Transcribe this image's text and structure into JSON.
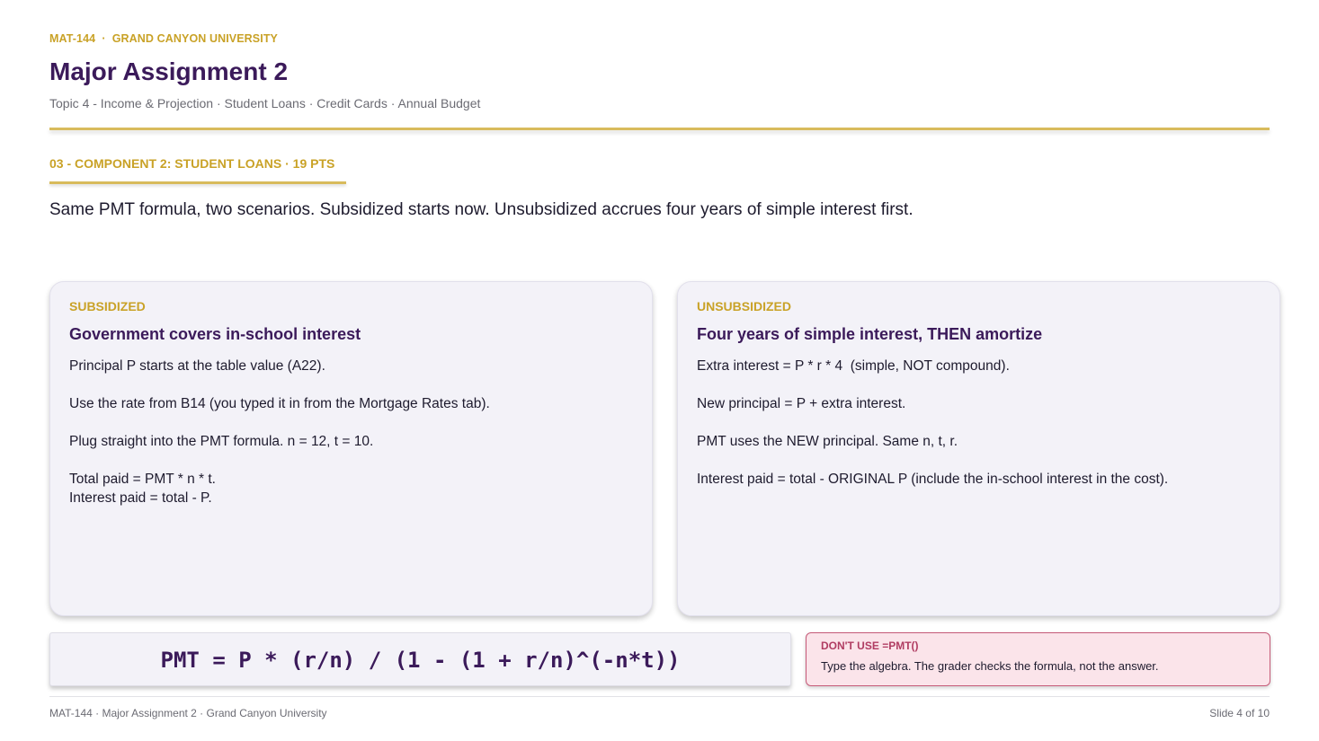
{
  "header": {
    "kicker": "MAT-144  ·  GRAND CANYON UNIVERSITY",
    "title": "Major Assignment 2",
    "subtitle": "Topic 4 - Income & Projection · Student Loans · Credit Cards · Annual Budget"
  },
  "section": {
    "label": "03 - COMPONENT 2: STUDENT LOANS · 19 PTS",
    "lead": "Same PMT formula, two scenarios. Subsidized starts now. Unsubsidized accrues four years of simple interest first."
  },
  "cards": [
    {
      "tag": "SUBSIDIZED",
      "title": "Government covers in-school interest",
      "lines": [
        "Principal P starts at the table value (A22).",
        "Use the rate from B14 (you typed it in from the Mortgage Rates tab).",
        "Plug straight into the PMT formula. n = 12, t = 10.",
        "Total paid = PMT * n * t.",
        "Interest paid = total - P."
      ]
    },
    {
      "tag": "UNSUBSIDIZED",
      "title": "Four years of simple interest, THEN amortize",
      "lines": [
        "Extra interest = P * r * 4  (simple, NOT compound).",
        "New principal = P + extra interest.",
        "PMT uses the NEW principal. Same n, t, r.",
        "Interest paid = total - ORIGINAL P (include the in-school interest in the cost)."
      ]
    }
  ],
  "formula": "PMT = P * (r/n) / (1 - (1 + r/n)^(-n*t))",
  "warning": {
    "title": "DON'T USE =PMT()",
    "text": "Type the algebra. The grader checks the formula, not the answer."
  },
  "footer": {
    "left": "MAT-144 · Major Assignment 2 · Grand Canyon University",
    "right": "Slide 4 of 10"
  }
}
